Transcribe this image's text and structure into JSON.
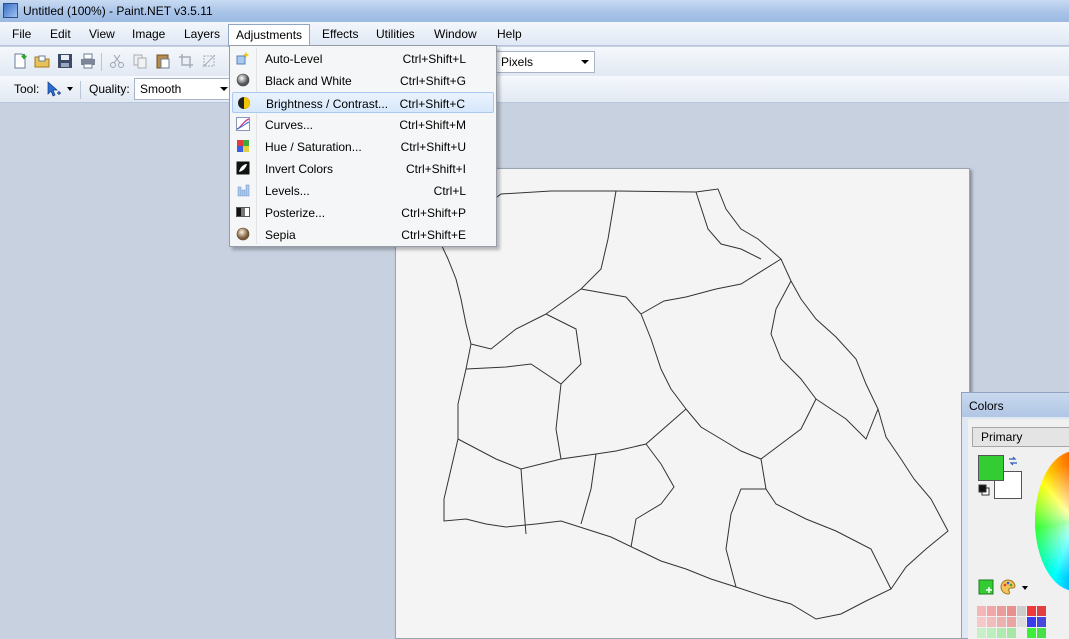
{
  "window": {
    "title": "Untitled (100%) - Paint.NET v3.5.11"
  },
  "menubar": {
    "items": [
      {
        "label": "File"
      },
      {
        "label": "Edit"
      },
      {
        "label": "View"
      },
      {
        "label": "Image"
      },
      {
        "label": "Layers"
      },
      {
        "label": "Adjustments"
      },
      {
        "label": "Effects"
      },
      {
        "label": "Utilities"
      },
      {
        "label": "Window"
      },
      {
        "label": "Help"
      }
    ],
    "active": "Adjustments"
  },
  "toolbar": {
    "units_value": "Pixels",
    "tool_label": "Tool:",
    "quality_label": "Quality:",
    "quality_value": "Smooth"
  },
  "adjustments_menu": {
    "items": [
      {
        "label": "Auto-Level",
        "shortcut": "Ctrl+Shift+L",
        "icon": "auto-level-icon"
      },
      {
        "label": "Black and White",
        "shortcut": "Ctrl+Shift+G",
        "icon": "black-and-white-icon"
      },
      {
        "label": "Brightness / Contrast...",
        "shortcut": "Ctrl+Shift+C",
        "icon": "brightness-contrast-icon",
        "highlighted": true
      },
      {
        "label": "Curves...",
        "shortcut": "Ctrl+Shift+M",
        "icon": "curves-icon"
      },
      {
        "label": "Hue / Saturation...",
        "shortcut": "Ctrl+Shift+U",
        "icon": "hue-saturation-icon"
      },
      {
        "label": "Invert Colors",
        "shortcut": "Ctrl+Shift+I",
        "icon": "invert-colors-icon"
      },
      {
        "label": "Levels...",
        "shortcut": "Ctrl+L",
        "icon": "levels-icon"
      },
      {
        "label": "Posterize...",
        "shortcut": "Ctrl+Shift+P",
        "icon": "posterize-icon"
      },
      {
        "label": "Sepia",
        "shortcut": "Ctrl+Shift+E",
        "icon": "sepia-icon"
      }
    ]
  },
  "colors_window": {
    "title": "Colors",
    "mode_value": "Primary",
    "primary_color": "#33cc33",
    "secondary_color": "#ffffff"
  }
}
